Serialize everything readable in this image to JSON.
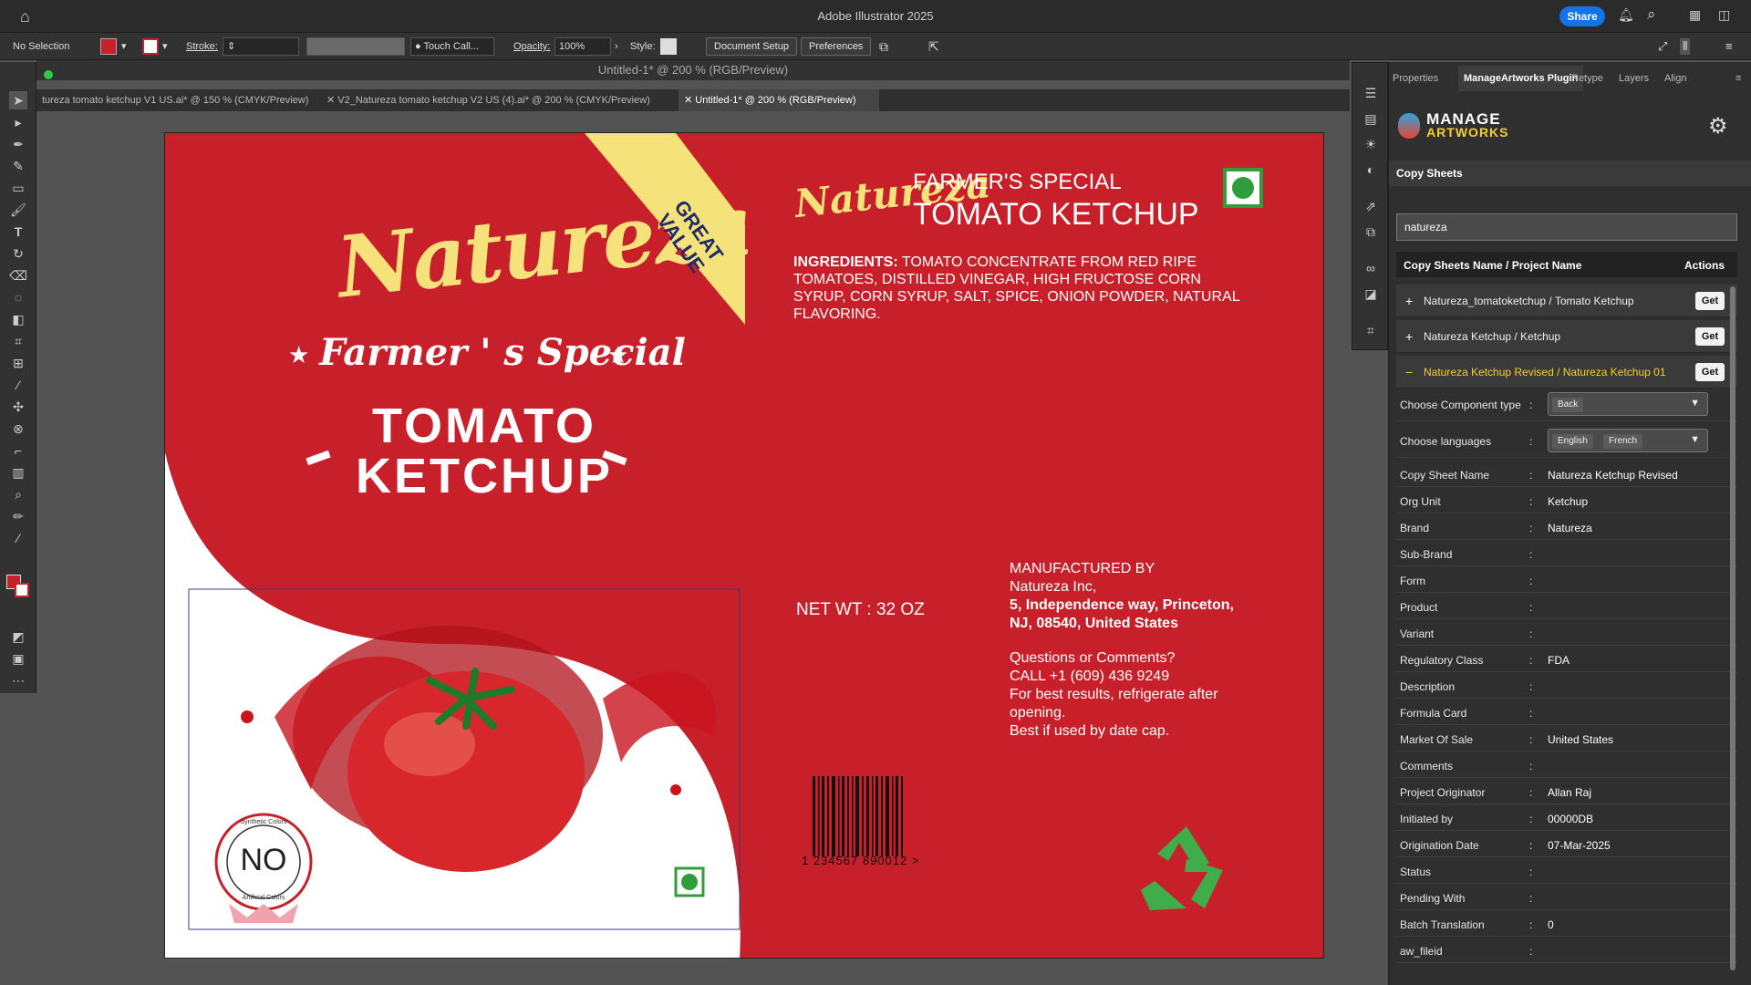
{
  "app": {
    "title": "Adobe Illustrator 2025",
    "share_label": "Share"
  },
  "controlbar": {
    "selection": "No Selection",
    "stroke_label": "Stroke:",
    "brush": "Touch Call...",
    "opacity_label": "Opacity:",
    "opacity_value": "100%",
    "style_label": "Style:",
    "document_setup": "Document Setup",
    "preferences": "Preferences",
    "fill_color": "#c8202a"
  },
  "document": {
    "title": "Untitled-1* @ 200 % (RGB/Preview)",
    "tabs": [
      {
        "label": "tureza tomato ketchup V1 US.ai* @ 150 % (CMYK/Preview)"
      },
      {
        "label": "V2_Natureza tomato ketchup V2 US (4).ai* @ 200 % (CMYK/Preview)"
      },
      {
        "label": "Untitled-1* @ 200 % (RGB/Preview)"
      }
    ]
  },
  "label": {
    "brand": "Natureza",
    "tagline": "Farmer ' s Special",
    "product_line1": "TOMATO",
    "product_line2": "KETCHUP",
    "banner": "GREAT VALUE",
    "header_small": "FARMER'S SPECIAL",
    "header_big": "TOMATO KETCHUP",
    "ingredients_label": "INGREDIENTS:",
    "ingredients_text": "TOMATO CONCENTRATE FROM RED RIPE TOMATOES, DISTILLED VINEGAR, HIGH FRUCTOSE CORN SYRUP, CORN SYRUP, SALT, SPICE, ONION POWDER, NATURAL FLAVORING.",
    "net_wt": "NET WT : 32 OZ",
    "mfd_by": "MANUFACTURED BY",
    "company": "Natureza Inc,",
    "address1": "5, Independence way, Princeton,",
    "address2": "NJ, 08540, United States",
    "q1": "Questions or Comments?",
    "q2": "CALL +1 (609) 436 9249",
    "q3": "For best results, refrigerate after",
    "q4": "opening.",
    "q5": "Best if used by date cap.",
    "barcode": "1 234567 890012 >",
    "no_badge": "NO",
    "badge_top": "Synthetic Colors",
    "badge_bottom": "Artificial Colors",
    "brand_red": "#c8202a",
    "brand_yellow": "#f6e27a"
  },
  "panel": {
    "tabs": [
      "Properties",
      "ManageArtworks Plugin",
      "Retype",
      "Layers",
      "Align"
    ],
    "logo_top": "MANAGE",
    "logo_bottom": "ARTWORKS",
    "section": "Copy Sheets",
    "search_value": "natureza",
    "col_name": "Copy Sheets Name / Project Name",
    "col_actions": "Actions",
    "get_label": "Get",
    "sheets": [
      {
        "sign": "+",
        "name": "Natureza_tomatoketchup / Tomato Ketchup"
      },
      {
        "sign": "+",
        "name": "Natureza Ketchup / Ketchup"
      },
      {
        "sign": "−",
        "name": "Natureza Ketchup Revised / Natureza Ketchup 01"
      }
    ],
    "component_label": "Choose Component type",
    "component_value": "Back",
    "languages_label": "Choose languages",
    "languages": [
      "English",
      "French"
    ],
    "fields": [
      {
        "label": "Copy Sheet Name",
        "value": "Natureza Ketchup Revised"
      },
      {
        "label": "Org Unit",
        "value": "Ketchup"
      },
      {
        "label": "Brand",
        "value": "Natureza"
      },
      {
        "label": "Sub-Brand",
        "value": ""
      },
      {
        "label": "Form",
        "value": ""
      },
      {
        "label": "Product",
        "value": ""
      },
      {
        "label": "Variant",
        "value": ""
      },
      {
        "label": "Regulatory Class",
        "value": "FDA"
      },
      {
        "label": "Description",
        "value": ""
      },
      {
        "label": "Formula Card",
        "value": ""
      },
      {
        "label": "Market Of Sale",
        "value": "United States"
      },
      {
        "label": "Comments",
        "value": ""
      },
      {
        "label": "Project Originator",
        "value": "Allan Raj"
      },
      {
        "label": "Initiated by",
        "value": "00000DB"
      },
      {
        "label": "Origination Date",
        "value": "07-Mar-2025"
      },
      {
        "label": "Status",
        "value": ""
      },
      {
        "label": "Pending With",
        "value": ""
      },
      {
        "label": "Batch Translation",
        "value": "0"
      },
      {
        "label": "aw_fileid",
        "value": ""
      }
    ]
  }
}
